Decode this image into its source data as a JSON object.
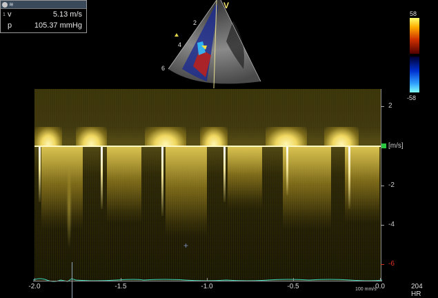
{
  "measurement_box": {
    "row1": {
      "index": "1",
      "key": "v",
      "value": "5.13 m/s"
    },
    "row2": {
      "index": "",
      "key": "p",
      "value": "105.37 mmHg"
    }
  },
  "sector": {
    "label_v": "V",
    "depth_marks": [
      "2",
      "4",
      "6"
    ]
  },
  "color_scale": {
    "top": "58",
    "bottom": "-58"
  },
  "velocity_scale": {
    "ticks": [
      "2",
      "[m/s]",
      "-2",
      "-4",
      "-6"
    ],
    "unit": "[m/s]"
  },
  "time_axis": {
    "ticks": [
      "-2.0",
      "-1.5",
      "-1.0",
      "-0.5",
      "0.0"
    ],
    "sweep_speed": "100 mm/s"
  },
  "heart_rate": {
    "value": "204",
    "label": "HR"
  },
  "colors": {
    "doppler": "#d8c040",
    "ecg": "#40e0c0",
    "scale_red": "#e03020",
    "marker_green": "#29c840"
  }
}
